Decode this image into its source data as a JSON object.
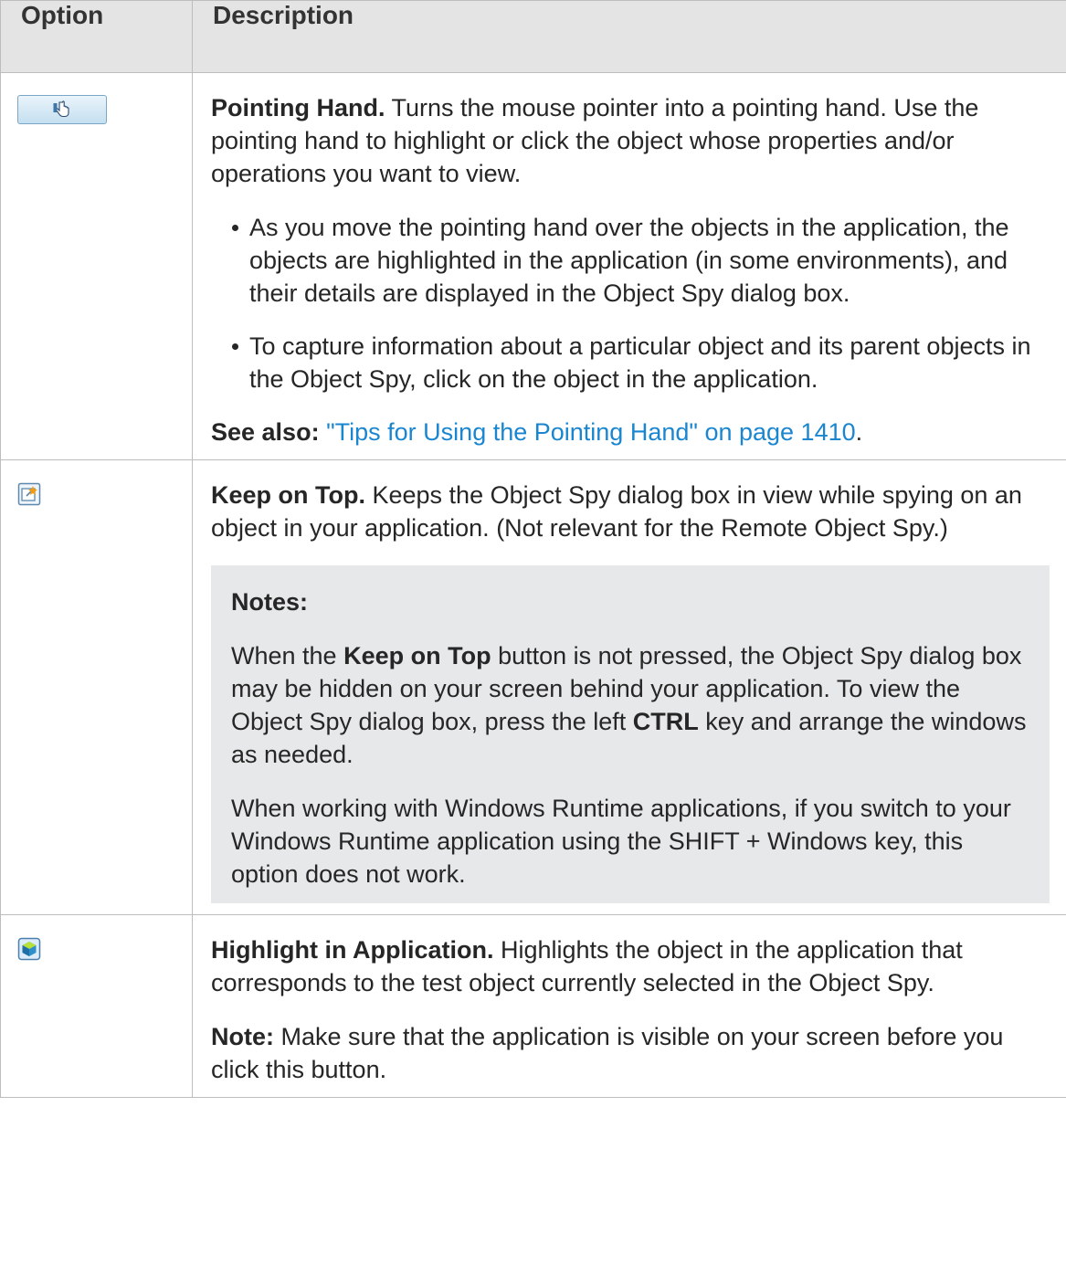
{
  "table": {
    "headers": {
      "option": "Option",
      "description": "Description"
    },
    "rows": {
      "pointing_hand": {
        "icon": "pointing-hand-icon",
        "title": "Pointing Hand.",
        "text": " Turns the mouse pointer into a pointing hand. Use the pointing hand to highlight or click the object whose properties and/or operations you want to view.",
        "bullets": [
          "As you move the pointing hand over the objects in the application, the objects are highlighted in the application (in some environments), and their details are displayed in the Object Spy dialog box.",
          "To capture information about a particular object and its parent objects in the Object Spy, click on the object in the application."
        ],
        "see_also_label": "See also:",
        "see_also_link": "\"Tips for Using the Pointing Hand\" on page 1410",
        "see_also_end": "."
      },
      "keep_on_top": {
        "icon": "keep-on-top-icon",
        "title": "Keep on Top.",
        "text": " Keeps the Object Spy dialog box in view while spying on an object in your application. (Not relevant for the Remote Object Spy.)",
        "notes_heading": "Notes:",
        "note1_a": "When the ",
        "note1_b": "Keep on Top",
        "note1_c": " button is not pressed, the Object Spy dialog box may be hidden on your screen behind your application. To view the Object Spy dialog box, press the left ",
        "note1_d": "CTRL",
        "note1_e": " key and arrange the windows as needed.",
        "note2": "When working with Windows Runtime applications, if you switch to your Windows Runtime application using the SHIFT + Windows key, this option does not work."
      },
      "highlight": {
        "icon": "highlight-in-application-icon",
        "title": "Highlight in Application.",
        "text": " Highlights the object in the application that corresponds to the test object currently selected in the Object Spy.",
        "note_label": "Note:",
        "note_text": " Make sure that the application is visible on your screen before you click this button."
      }
    }
  },
  "colors": {
    "link": "#1a86d0",
    "header_bg": "#e4e4e4",
    "note_bg": "#e6e8e9"
  }
}
